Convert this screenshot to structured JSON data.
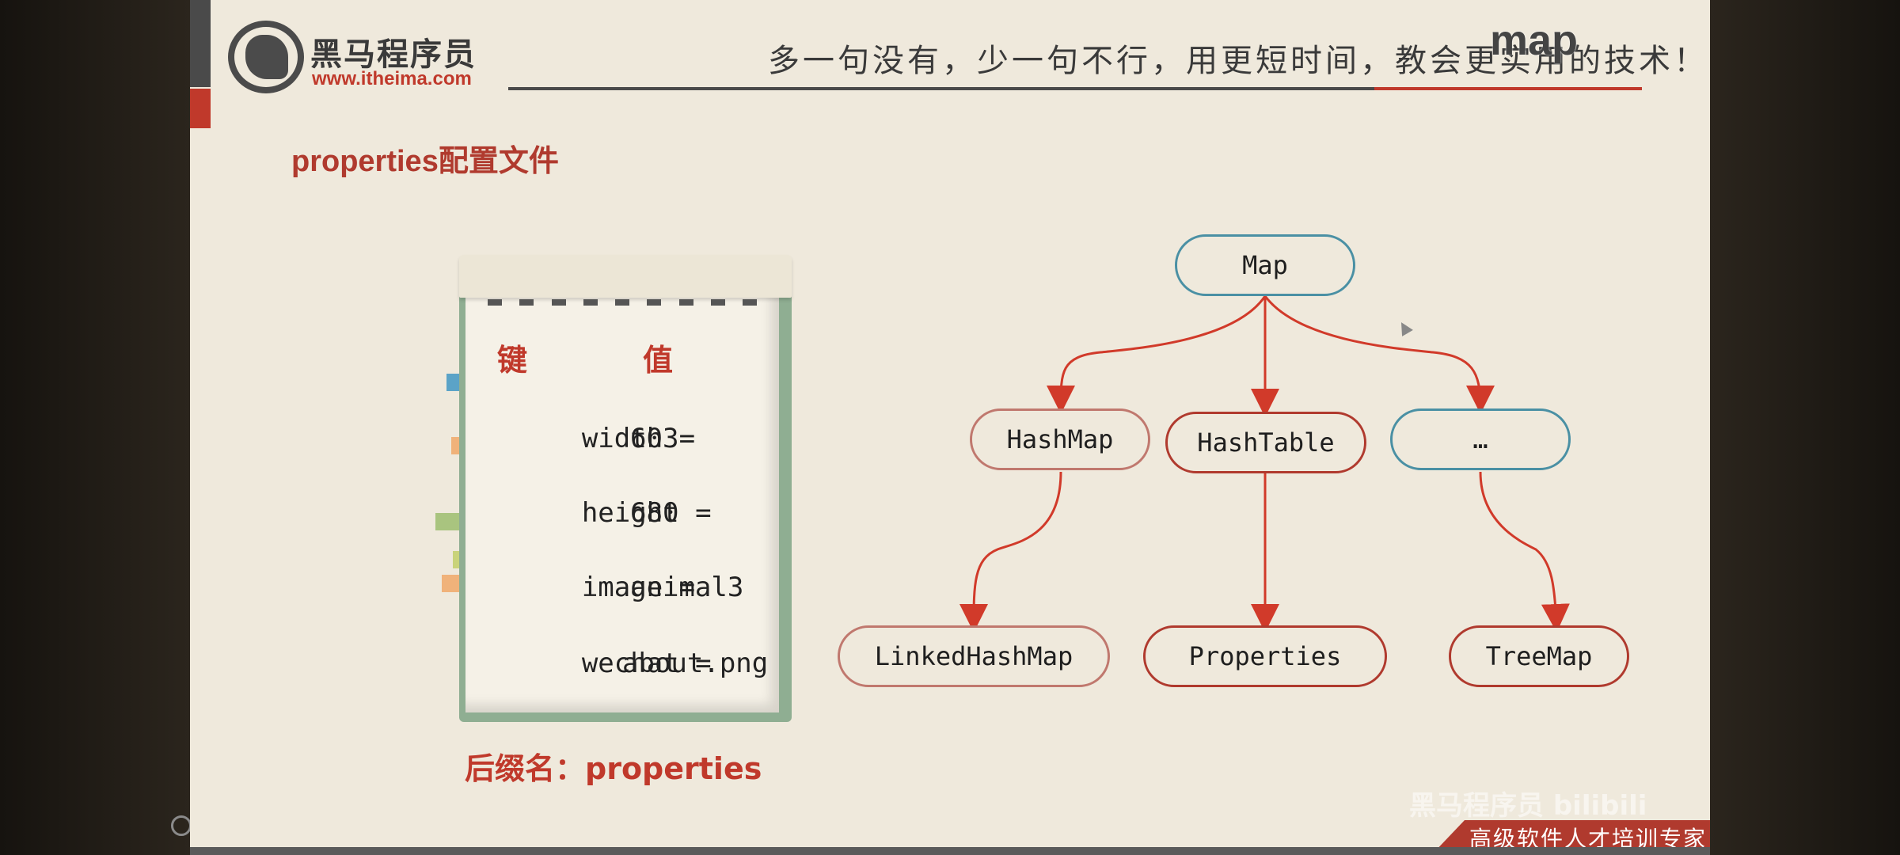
{
  "header": {
    "logo_text": "黑马程序员",
    "logo_url": "www.itheima.com",
    "slogan": "多一句没有，少一句不行，用更短时间，教会更实用的技术！",
    "overlay_text": "map"
  },
  "section": {
    "title": "properties配置文件"
  },
  "notepad": {
    "key_header": "键",
    "value_header": "值",
    "lines": [
      {
        "key": "width =",
        "value": "603"
      },
      {
        "key": "height =",
        "value": "680"
      },
      {
        "key": "image =",
        "value": "animal3"
      },
      {
        "key": "wechat =",
        "value": "about.png"
      }
    ],
    "suffix_label": "后缀名：properties"
  },
  "diagram": {
    "root": "Map",
    "children": [
      "HashMap",
      "HashTable",
      "…"
    ],
    "grandchildren": [
      "LinkedHashMap",
      "Properties",
      "TreeMap"
    ],
    "colors": {
      "teal": "#4a90a4",
      "red": "#b03a2e",
      "arrow": "#d13a2a"
    }
  },
  "footer": {
    "tagline": "高级软件人才培训专家",
    "watermark": "黑马程序员 bilibili"
  }
}
